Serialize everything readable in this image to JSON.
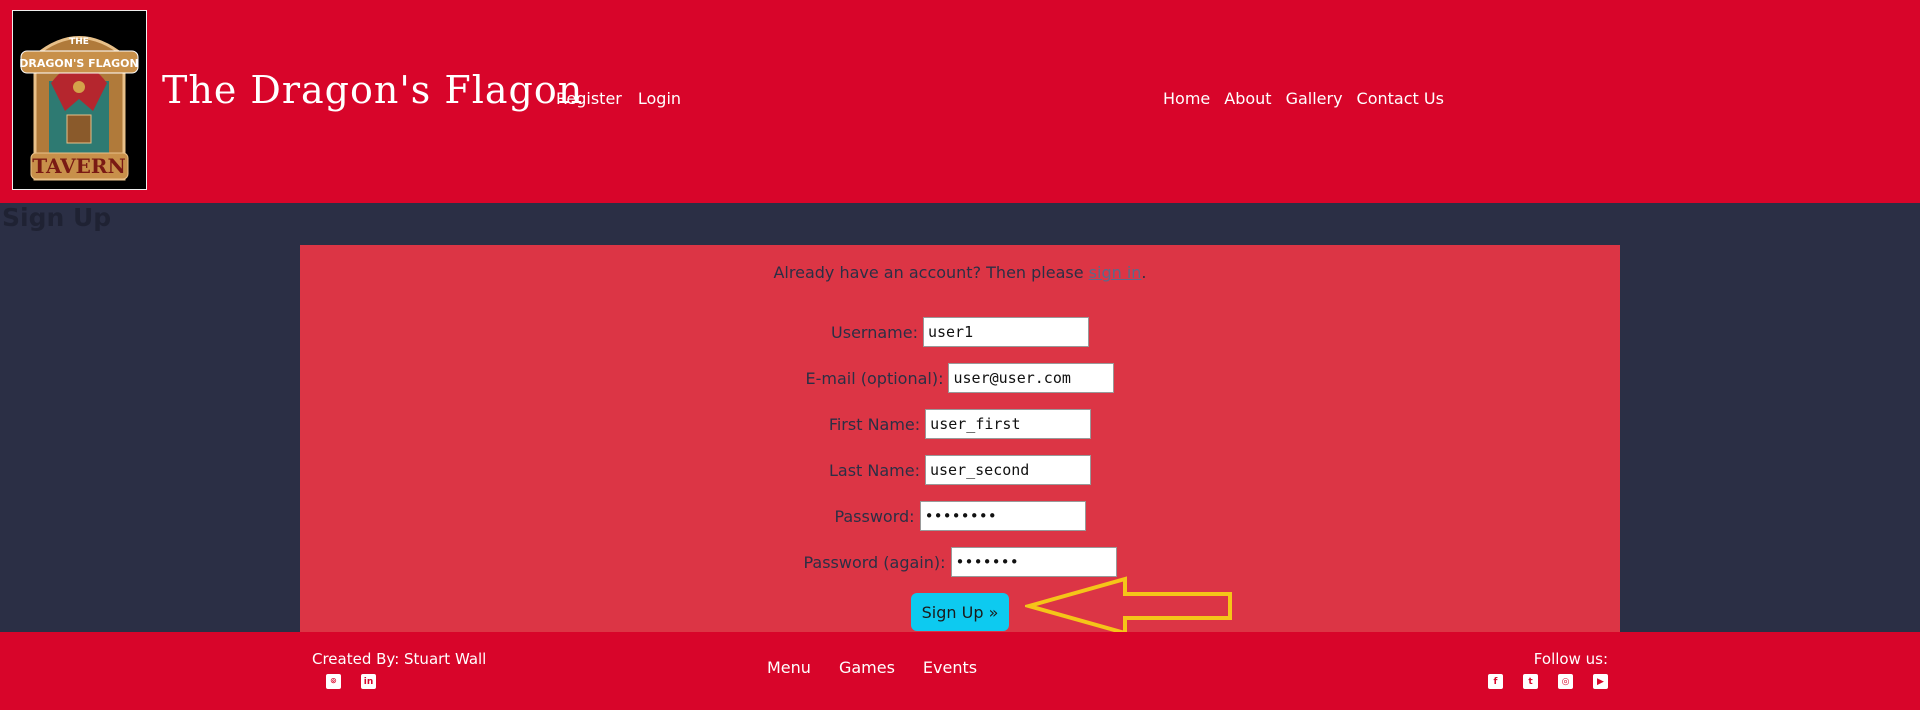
{
  "header": {
    "logo_text": [
      "THE",
      "DRAGON'S FLAGON",
      "TAVERN"
    ],
    "site_title": "The Dragon's Flagon",
    "auth_nav": [
      "Register",
      "Login"
    ],
    "main_nav": [
      "Home",
      "About",
      "Gallery",
      "Contact Us"
    ]
  },
  "page": {
    "title": "Sign Up"
  },
  "form": {
    "notice_prefix": "Already have an account? Then please ",
    "notice_link": "sign in",
    "notice_suffix": ".",
    "fields": [
      {
        "label": "Username:",
        "value": "user1"
      },
      {
        "label": "E-mail (optional):",
        "value": "user@user.com"
      },
      {
        "label": "First Name:",
        "value": "user_first"
      },
      {
        "label": "Last Name:",
        "value": "user_second"
      },
      {
        "label": "Password:",
        "value": "••••••••"
      },
      {
        "label": "Password (again):",
        "value": "•••••••"
      }
    ],
    "submit_label": "Sign Up »"
  },
  "footer": {
    "credit": "Created By: Stuart Wall",
    "nav": [
      "Menu",
      "Games",
      "Events"
    ],
    "follow_label": "Follow us:",
    "left_icons": [
      "github-icon",
      "linkedin-icon"
    ],
    "right_icons": [
      "facebook-icon",
      "twitter-icon",
      "instagram-icon",
      "youtube-icon"
    ]
  },
  "colors": {
    "brand_red": "#d8052a",
    "panel_red": "#dc3545",
    "background": "#2b2f45",
    "button_cyan": "#0dcaf0",
    "annotation_yellow": "#f5c518"
  }
}
